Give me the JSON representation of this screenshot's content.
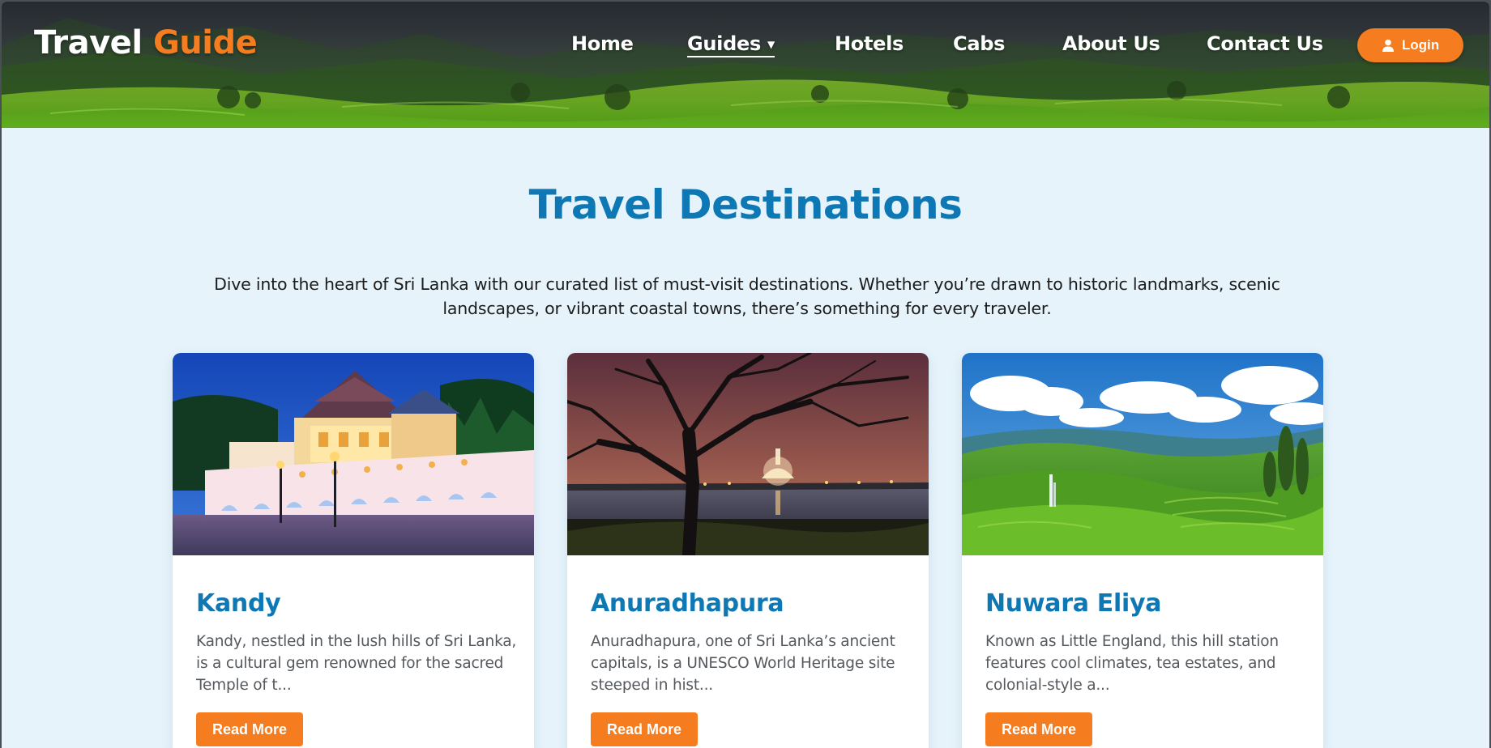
{
  "header": {
    "logo": {
      "part1": "Travel",
      "part2": "Guide"
    },
    "nav": [
      {
        "label": "Home"
      },
      {
        "label": "Guides"
      },
      {
        "label": "Hotels"
      },
      {
        "label": "Cabs"
      },
      {
        "label": "About Us"
      },
      {
        "label": "Contact Us"
      }
    ],
    "login_label": "Login"
  },
  "main": {
    "title": "Travel Destinations",
    "intro": "Dive into the heart of Sri Lanka with our curated list of must-visit destinations. Whether you’re drawn to historic landmarks, scenic landscapes, or vibrant coastal towns, there’s something for every traveler.",
    "cards": [
      {
        "title": "Kandy",
        "text": "Kandy, nestled in the lush hills of Sri Lanka, is a cultural gem renowned for the sacred Temple of t...",
        "button": "Read More"
      },
      {
        "title": "Anuradhapura",
        "text": "Anuradhapura, one of Sri Lanka’s ancient capitals, is a UNESCO World Heritage site steeped in hist...",
        "button": "Read More"
      },
      {
        "title": "Nuwara Eliya",
        "text": "Known as Little England, this hill station features cool climates, tea estates, and colonial-style a...",
        "button": "Read More"
      }
    ]
  },
  "colors": {
    "brand_orange": "#f57c1f",
    "title_blue": "#0e78b5",
    "page_bg": "#e6f3fb"
  },
  "icons": {
    "login": "user-icon",
    "dropdown": "caret-down-icon"
  }
}
